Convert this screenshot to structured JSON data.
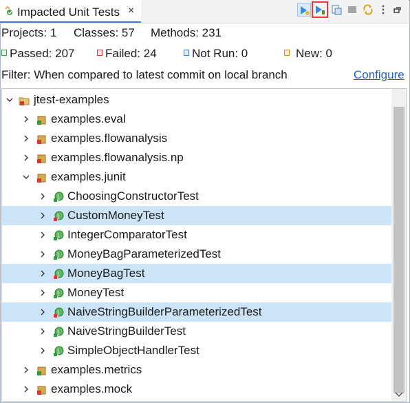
{
  "tab": {
    "title": "Impacted Unit Tests",
    "close": "×"
  },
  "toolbar": {
    "icons": [
      "run-tests-icon",
      "run-selected-icon",
      "export-icon",
      "stop-icon",
      "sync-icon",
      "view-menu-icon",
      "minimize-icon"
    ]
  },
  "summary": {
    "projects": "Projects: 1",
    "classes": "Classes: 57",
    "methods": "Methods: 231",
    "passed": "Passed: 207",
    "failed": "Failed: 24",
    "not_run": "Not Run: 0",
    "new": "New: 0"
  },
  "filter": {
    "text": "Filter: When compared to latest commit on local branch",
    "link": "Configure"
  },
  "tree": {
    "root": "jtest-examples",
    "packages": {
      "eval": "examples.eval",
      "flowanalysis": "examples.flowanalysis",
      "flowanalysis_np": "examples.flowanalysis.np",
      "junit": "examples.junit",
      "metrics": "examples.metrics",
      "mock": "examples.mock"
    },
    "tests": [
      {
        "label": "ChoosingConstructorTest",
        "status": "passed",
        "selected": false
      },
      {
        "label": "CustomMoneyTest",
        "status": "failed",
        "selected": true
      },
      {
        "label": "IntegerComparatorTest",
        "status": "passed",
        "selected": false
      },
      {
        "label": "MoneyBagParameterizedTest",
        "status": "passed",
        "selected": false
      },
      {
        "label": "MoneyBagTest",
        "status": "failed",
        "selected": true
      },
      {
        "label": "MoneyTest",
        "status": "passed",
        "selected": false
      },
      {
        "label": "NaiveStringBuilderParameterizedTest",
        "status": "failed",
        "selected": true
      },
      {
        "label": "NaiveStringBuilderTest",
        "status": "passed",
        "selected": false
      },
      {
        "label": "SimpleObjectHandlerTest",
        "status": "passed",
        "selected": false
      }
    ]
  },
  "colors": {
    "accent": "#3b7bd6",
    "selection": "#cce4f7",
    "link": "#1a64c8",
    "passed": "#2e9b43",
    "failed": "#d23a3a",
    "highlight_box": "#e33c3c"
  }
}
